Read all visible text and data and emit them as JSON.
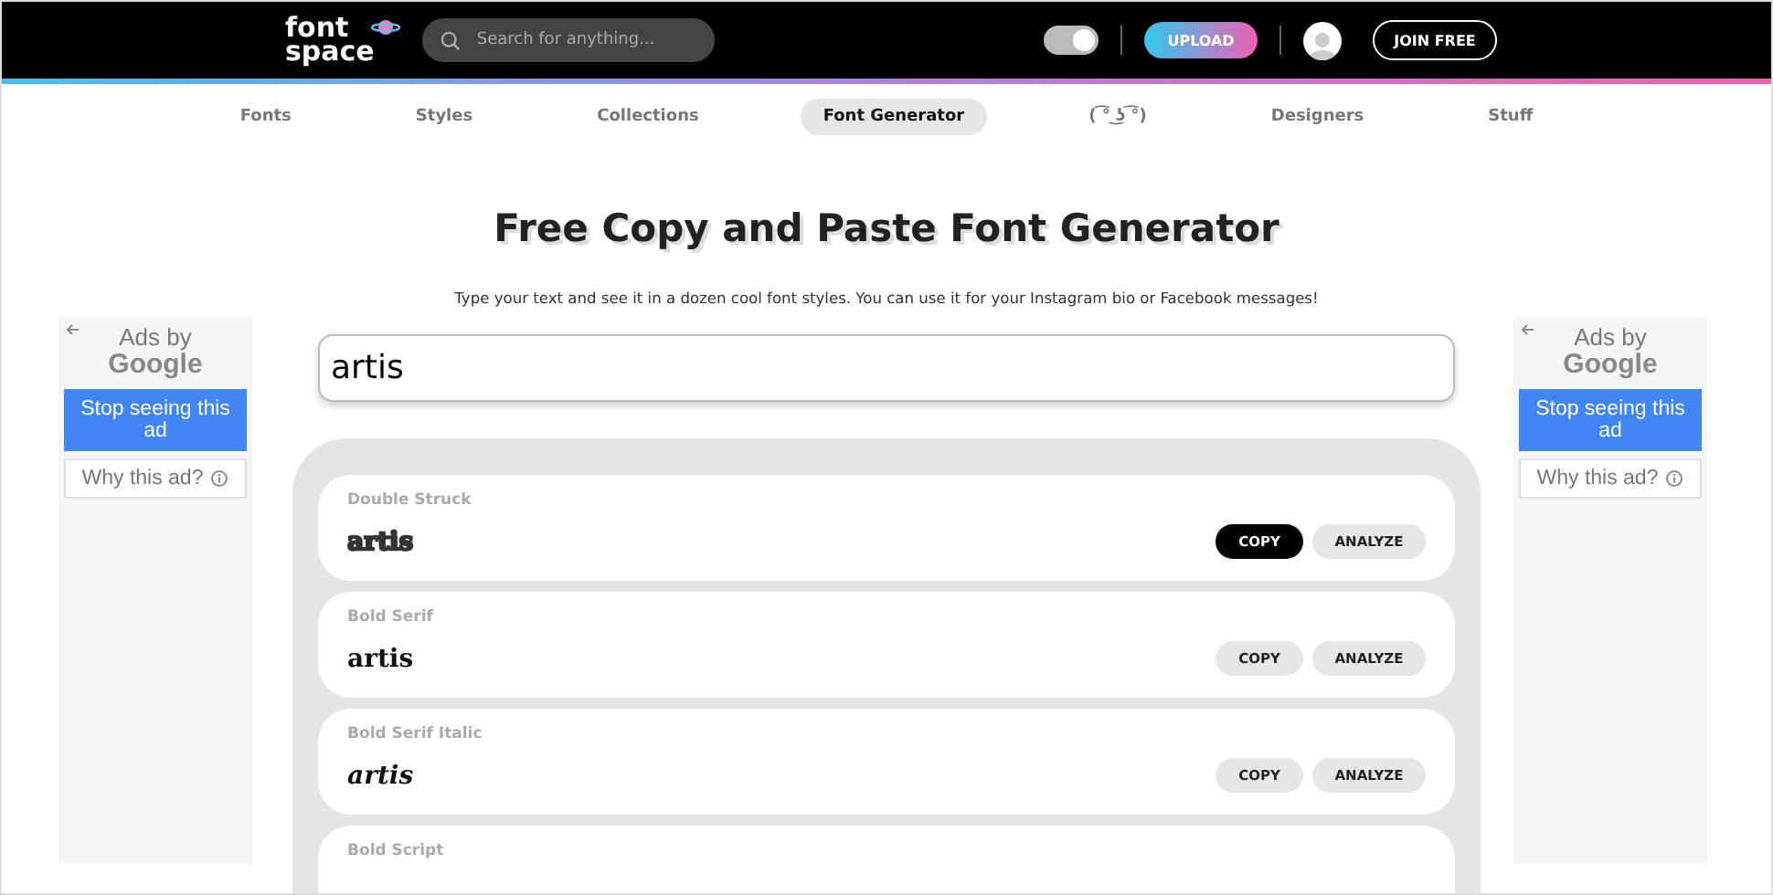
{
  "header": {
    "logo_top": "font",
    "logo_bottom": "space",
    "search": {
      "placeholder": "Search for anything..."
    },
    "upload": "UPLOAD",
    "join": "JOIN FREE",
    "dark_mode": true
  },
  "nav": [
    {
      "label": "Fonts",
      "selected": false
    },
    {
      "label": "Styles",
      "selected": false
    },
    {
      "label": "Collections",
      "selected": false
    },
    {
      "label": "Font Generator",
      "selected": true
    },
    {
      "label": "( ͡° ͜ʖ ͡°)",
      "selected": false
    },
    {
      "label": "Designers",
      "selected": false
    },
    {
      "label": "Stuff",
      "selected": false
    }
  ],
  "title": "Free Copy and Paste Font Generator",
  "subtitle": "Type your text and see it in a dozen cool font styles. You can use it for your Instagram bio or Facebook messages!",
  "input": {
    "value": "artis"
  },
  "ads": [
    {
      "line1": "Ads by",
      "line2": "Google",
      "stop": "Stop seeing this ad",
      "why": "Why this ad?"
    },
    {
      "line1": "Ads by",
      "line2": "Google",
      "stop": "Stop seeing this ad",
      "why": "Why this ad?"
    }
  ],
  "styles": [
    {
      "name": "Double Struck",
      "kind": "double",
      "sample": "𝕒𝕣𝕥𝕚𝕤",
      "copy": "COPY",
      "copy_active": true,
      "analyze": "ANALYZE"
    },
    {
      "name": "Bold Serif",
      "kind": "bold",
      "sample": "𝐚𝐫𝐭𝐢𝐬",
      "copy": "COPY",
      "copy_active": false,
      "analyze": "ANALYZE"
    },
    {
      "name": "Bold Serif Italic",
      "kind": "italic",
      "sample": "𝒂𝒓𝒕𝒊𝒔",
      "copy": "COPY",
      "copy_active": false,
      "analyze": "ANALYZE"
    },
    {
      "name": "Bold Script"
    }
  ]
}
